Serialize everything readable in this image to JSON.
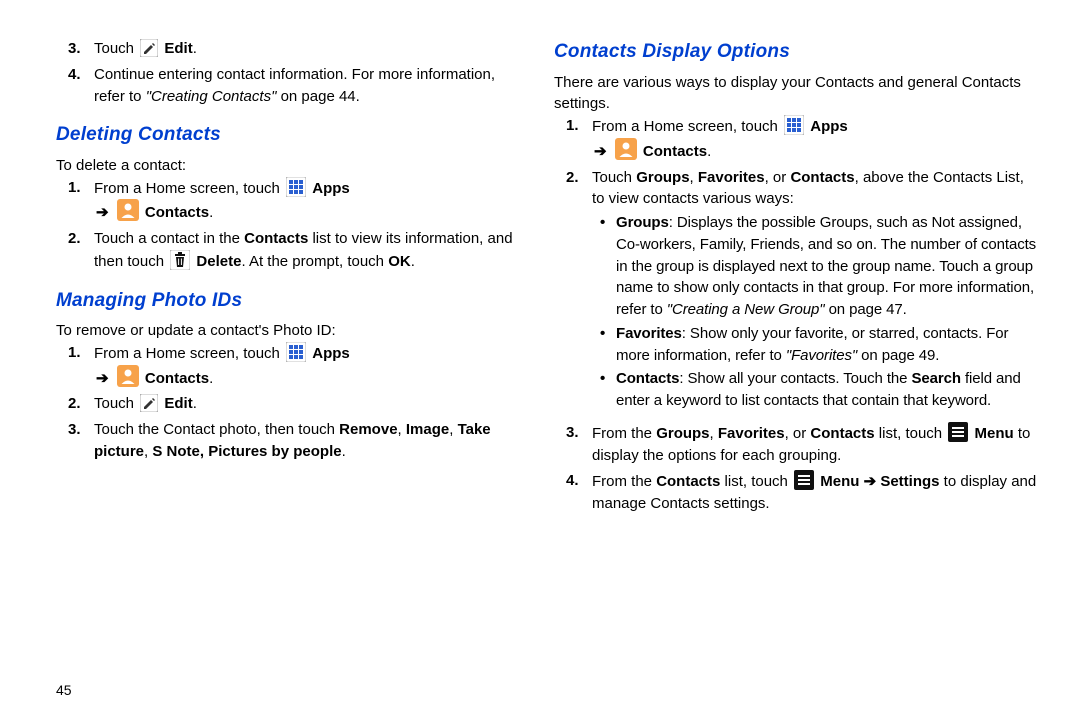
{
  "pageNumber": "45",
  "left": {
    "step3": {
      "n": "3.",
      "pre": "Touch ",
      "bold": "Edit",
      "post": "."
    },
    "step4": {
      "n": "4.",
      "t1": "Continue entering contact information. For more information, refer to ",
      "ref": "\"Creating Contacts\"",
      "t2": " on page 44."
    },
    "deleting": {
      "title": "Deleting Contacts",
      "intro": "To delete a contact:",
      "s1": {
        "n": "1.",
        "t1": "From a Home screen, touch ",
        "apps": "Apps",
        "contacts": "Contacts",
        "arrow": "➔",
        "post": "."
      },
      "s2": {
        "n": "2.",
        "t1": "Touch a contact in the ",
        "b1": "Contacts",
        "t2": " list to view its information, and then touch ",
        "b2": "Delete",
        "t3": ". At the prompt, touch ",
        "b3": "OK",
        "t4": "."
      }
    },
    "photo": {
      "title": "Managing Photo IDs",
      "intro": "To remove or update a contact's Photo ID:",
      "s1": {
        "n": "1.",
        "t1": "From a Home screen, touch ",
        "apps": "Apps",
        "contacts": "Contacts",
        "arrow": "➔",
        "post": "."
      },
      "s2": {
        "n": "2.",
        "pre": "Touch ",
        "bold": "Edit",
        "post": "."
      },
      "s3": {
        "n": "3.",
        "t1": "Touch the Contact photo, then touch ",
        "b1": "Remove",
        "c1": ", ",
        "b2": "Image",
        "c2": ", ",
        "b3": "Take picture",
        "c3": ", ",
        "b4": "S Note, Pictures by people",
        "post": "."
      }
    }
  },
  "right": {
    "title": "Contacts Display Options",
    "intro": "There are various ways to display your Contacts and general Contacts settings.",
    "s1": {
      "n": "1.",
      "t1": "From a Home screen, touch ",
      "apps": "Apps",
      "contacts": "Contacts",
      "arrow": "➔",
      "post": "."
    },
    "s2": {
      "n": "2.",
      "t1": "Touch ",
      "b1": "Groups",
      "c1": ", ",
      "b2": "Favorites",
      "c2": ", or ",
      "b3": "Contacts",
      "t2": ", above the Contacts List, to view contacts various ways:"
    },
    "b_groups": {
      "b": "Groups",
      "t": ": Displays the possible Groups, such as Not assigned, Co-workers, Family, Friends, and so on. The number of contacts in the group is displayed next to the group name. Touch a group name to show only contacts in that group. For more information, refer to ",
      "ref": "\"Creating a New Group\"",
      "t2": " on page 47."
    },
    "b_fav": {
      "b": "Favorites",
      "t": ": Show only your favorite, or starred, contacts. For more information, refer to ",
      "ref": "\"Favorites\"",
      "t2": " on page 49."
    },
    "b_con": {
      "b": "Contacts",
      "t": ": Show all your contacts. Touch the ",
      "b2": "Search",
      "t2": " field and enter a keyword to list contacts that contain that keyword."
    },
    "s3": {
      "n": "3.",
      "t1": "From the ",
      "b1": "Groups",
      "c1": ", ",
      "b2": "Favorites",
      "c2": ", or ",
      "b3": "Contacts",
      "t2": " list, touch ",
      "b4": "Menu",
      "t3": " to display the options for each grouping."
    },
    "s4": {
      "n": "4.",
      "t1": "From the ",
      "b1": "Contacts",
      "t2": " list, touch ",
      "b2": "Menu",
      "arrow": " ➔ ",
      "b3": "Settings",
      "t3": " to display and manage Contacts settings."
    }
  }
}
